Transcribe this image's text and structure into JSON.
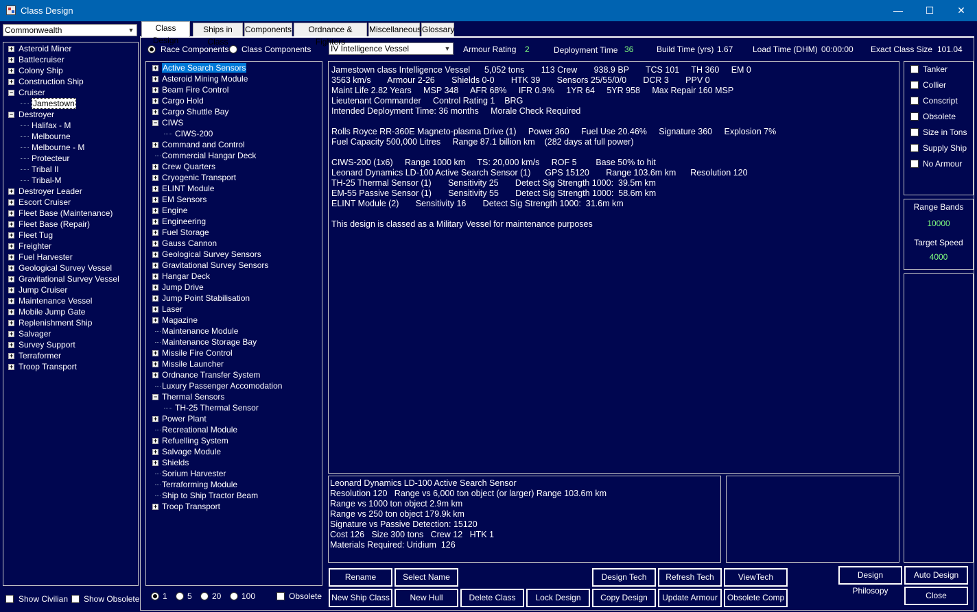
{
  "window": {
    "title": "Class Design",
    "minimize": "—",
    "maximize": "☐",
    "close": "✕"
  },
  "race_select": "Commonwealth",
  "class_tree": [
    {
      "label": "Asteroid Miner",
      "exp": "+"
    },
    {
      "label": "Battlecruiser",
      "exp": "+"
    },
    {
      "label": "Colony Ship",
      "exp": "+"
    },
    {
      "label": "Construction Ship",
      "exp": "+"
    },
    {
      "label": "Cruiser",
      "exp": "−"
    },
    {
      "label": "Jamestown",
      "child": true,
      "selected": true
    },
    {
      "label": "Destroyer",
      "exp": "−"
    },
    {
      "label": "Halifax - M",
      "child": true
    },
    {
      "label": "Melbourne",
      "child": true
    },
    {
      "label": "Melbourne - M",
      "child": true
    },
    {
      "label": "Protecteur",
      "child": true
    },
    {
      "label": "Tribal II",
      "child": true
    },
    {
      "label": "Tribal-M",
      "child": true
    },
    {
      "label": "Destroyer Leader",
      "exp": "+"
    },
    {
      "label": "Escort Cruiser",
      "exp": "+"
    },
    {
      "label": "Fleet Base (Maintenance)",
      "exp": "+"
    },
    {
      "label": "Fleet Base (Repair)",
      "exp": "+"
    },
    {
      "label": "Fleet Tug",
      "exp": "+"
    },
    {
      "label": "Freighter",
      "exp": "+"
    },
    {
      "label": "Fuel Harvester",
      "exp": "+"
    },
    {
      "label": "Geological Survey Vessel",
      "exp": "+"
    },
    {
      "label": "Gravitational Survey Vessel",
      "exp": "+"
    },
    {
      "label": "Jump Cruiser",
      "exp": "+"
    },
    {
      "label": "Maintenance Vessel",
      "exp": "+"
    },
    {
      "label": "Mobile Jump Gate",
      "exp": "+"
    },
    {
      "label": "Replenishment Ship",
      "exp": "+"
    },
    {
      "label": "Salvager",
      "exp": "+"
    },
    {
      "label": "Survey Support",
      "exp": "+"
    },
    {
      "label": "Terraformer",
      "exp": "+"
    },
    {
      "label": "Troop Transport",
      "exp": "+"
    }
  ],
  "bottom_left": {
    "show_civilian": "Show Civilian",
    "show_obsolete": "Show Obsolete"
  },
  "tabs": [
    "Class Design",
    "Ships in Class",
    "Components",
    "Ordnance & Fighters",
    "Miscellaneous",
    "Glossary"
  ],
  "component_source": {
    "race": "Race Components",
    "class": "Class Components"
  },
  "component_tree": [
    {
      "label": "Active Search Sensors",
      "exp": "+",
      "selected": true
    },
    {
      "label": "Asteroid Mining Module",
      "exp": "+"
    },
    {
      "label": "Beam Fire Control",
      "exp": "+"
    },
    {
      "label": "Cargo Hold",
      "exp": "+"
    },
    {
      "label": "Cargo Shuttle Bay",
      "exp": "+"
    },
    {
      "label": "CIWS",
      "exp": "−"
    },
    {
      "label": "CIWS-200",
      "child": true
    },
    {
      "label": "Command and Control",
      "exp": "+"
    },
    {
      "label": "Commercial Hangar Deck",
      "exp": ""
    },
    {
      "label": "Crew Quarters",
      "exp": "+"
    },
    {
      "label": "Cryogenic Transport",
      "exp": "+"
    },
    {
      "label": "ELINT Module",
      "exp": "+"
    },
    {
      "label": "EM Sensors",
      "exp": "+"
    },
    {
      "label": "Engine",
      "exp": "+"
    },
    {
      "label": "Engineering",
      "exp": "+"
    },
    {
      "label": "Fuel Storage",
      "exp": "+"
    },
    {
      "label": "Gauss Cannon",
      "exp": "+"
    },
    {
      "label": "Geological Survey Sensors",
      "exp": "+"
    },
    {
      "label": "Gravitational Survey Sensors",
      "exp": "+"
    },
    {
      "label": "Hangar Deck",
      "exp": "+"
    },
    {
      "label": "Jump Drive",
      "exp": "+"
    },
    {
      "label": "Jump Point Stabilisation",
      "exp": "+"
    },
    {
      "label": "Laser",
      "exp": "+"
    },
    {
      "label": "Magazine",
      "exp": "+"
    },
    {
      "label": "Maintenance Module",
      "exp": ""
    },
    {
      "label": "Maintenance Storage Bay",
      "exp": ""
    },
    {
      "label": "Missile Fire Control",
      "exp": "+"
    },
    {
      "label": "Missile Launcher",
      "exp": "+"
    },
    {
      "label": "Ordnance Transfer System",
      "exp": "+"
    },
    {
      "label": "Luxury Passenger Accomodation",
      "exp": ""
    },
    {
      "label": "Thermal Sensors",
      "exp": "−"
    },
    {
      "label": "TH-25 Thermal Sensor",
      "child": true
    },
    {
      "label": "Power Plant",
      "exp": "+"
    },
    {
      "label": "Recreational Module",
      "exp": ""
    },
    {
      "label": "Refuelling System",
      "exp": "+"
    },
    {
      "label": "Salvage Module",
      "exp": "+"
    },
    {
      "label": "Shields",
      "exp": "+"
    },
    {
      "label": "Sorium Harvester",
      "exp": ""
    },
    {
      "label": "Terraforming Module",
      "exp": ""
    },
    {
      "label": "Ship to Ship Tractor Beam",
      "exp": ""
    },
    {
      "label": "Troop Transport",
      "exp": "+"
    }
  ],
  "qty_options": [
    "1",
    "5",
    "20",
    "100"
  ],
  "obsolete_label": "Obsolete",
  "hull_select": "IV Intelligence Vessel",
  "stats": {
    "armour_label": "Armour Rating",
    "armour": "2",
    "deploy_label": "Deployment Time",
    "deploy": "36",
    "build_label": "Build Time (yrs)",
    "build": "1.67",
    "load_label": "Load Time (DHM)",
    "load": "00:00:00",
    "size_label": "Exact Class Size",
    "size": "101.04"
  },
  "design_text": [
    "Jamestown class Intelligence Vessel      5,052 tons       113 Crew       938.9 BP       TCS 101     TH 360     EM 0",
    "3563 km/s       Armour 2-26       Shields 0-0       HTK 39       Sensors 25/55/0/0       DCR 3       PPV 0",
    "Maint Life 2.82 Years     MSP 348     AFR 68%     IFR 0.9%     1YR 64     5YR 958     Max Repair 160 MSP",
    "Lieutenant Commander     Control Rating 1    BRG",
    "Intended Deployment Time: 36 months     Morale Check Required",
    "",
    "Rolls Royce RR-360E Magneto-plasma Drive (1)     Power 360     Fuel Use 20.46%     Signature 360     Explosion 7%",
    "Fuel Capacity 500,000 Litres     Range 87.1 billion km    (282 days at full power)",
    "",
    "CIWS-200 (1x6)     Range 1000 km     TS: 20,000 km/s     ROF 5        Base 50% to hit",
    "Leonard Dynamics LD-100 Active Search Sensor (1)      GPS 15120       Range 103.6m km      Resolution 120",
    "TH-25 Thermal Sensor (1)       Sensitivity 25       Detect Sig Strength 1000:  39.5m km",
    "EM-55 Passive Sensor (1)       Sensitivity 55       Detect Sig Strength 1000:  58.6m km",
    "ELINT Module (2)       Sensitivity 16       Detect Sig Strength 1000:  31.6m km",
    "",
    "This design is classed as a Military Vessel for maintenance purposes"
  ],
  "component_detail": [
    "Leonard Dynamics LD-100 Active Search Sensor",
    "Resolution 120   Range vs 6,000 ton object (or larger) Range 103.6m km",
    "Range vs 1000 ton object 2.9m km",
    "Range vs 250 ton object 179.9k km",
    "Signature vs Passive Detection: 15120",
    "Cost 126   Size 300 tons   Crew 12   HTK 1",
    "Materials Required: Uridium  126"
  ],
  "flags": [
    "Tanker",
    "Collier",
    "Conscript",
    "Obsolete",
    "Size in Tons",
    "Supply Ship",
    "No Armour"
  ],
  "range_bands": {
    "label": "Range Bands",
    "value": "10000",
    "speed_label": "Target Speed",
    "speed": "4000"
  },
  "buttons": {
    "rename": "Rename",
    "select_name": "Select Name",
    "design_tech": "Design Tech",
    "refresh_tech": "Refresh Tech",
    "view_tech": "ViewTech",
    "design_philosophy": "Design Philosopy",
    "auto_design": "Auto Design",
    "new_ship_class": "New Ship Class",
    "new_hull": "New Hull",
    "delete_class": "Delete Class",
    "lock_design": "Lock Design",
    "copy_design": "Copy Design",
    "update_armour": "Update Armour",
    "obsolete_comp": "Obsolete Comp",
    "close": "Close"
  },
  "colors": {
    "background": "#000650",
    "titlebar": "#0063b1",
    "highlight": "#0078d7",
    "value_green": "#80ff80"
  }
}
